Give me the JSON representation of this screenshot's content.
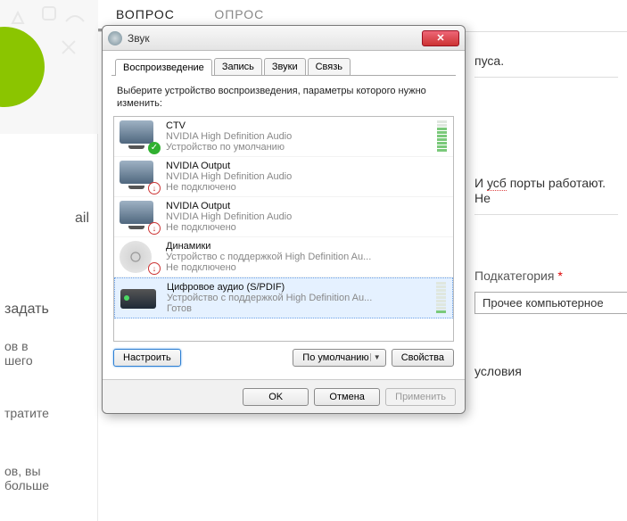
{
  "bg": {
    "tab_question": "ВОПРОС",
    "tab_poll": "ОПРОС",
    "left_ail": "ail",
    "left_zadat": "задать",
    "left_l3": "ов в",
    "left_l4": "шего",
    "left_l5": "тратите",
    "left_l6": "ов, вы",
    "left_l7": "больше",
    "right_t1": "пуса.",
    "right_t2a": "И ",
    "right_t2b": "усб",
    "right_t2c": " порты работают. Не",
    "cat_label": "Подкатегория ",
    "cat_req": "*",
    "cat_value": "Прочее компьютерное",
    "conditions": "условия"
  },
  "dialog": {
    "title": "Звук",
    "tabs": {
      "playback": "Воспроизведение",
      "record": "Запись",
      "sounds": "Звуки",
      "comm": "Связь"
    },
    "instruction": "Выберите устройство воспроизведения, параметры которого нужно изменить:",
    "devices": [
      {
        "name": "CTV",
        "driver": "NVIDIA High Definition Audio",
        "status": "Устройство по умолчанию",
        "icon": "monitor",
        "badge": "check",
        "level": 7
      },
      {
        "name": "NVIDIA Output",
        "driver": "NVIDIA High Definition Audio",
        "status": "Не подключено",
        "icon": "monitor",
        "badge": "down",
        "level": 0
      },
      {
        "name": "NVIDIA Output",
        "driver": "NVIDIA High Definition Audio",
        "status": "Не подключено",
        "icon": "monitor",
        "badge": "down",
        "level": 0
      },
      {
        "name": "Динамики",
        "driver": "Устройство с поддержкой High Definition Au...",
        "status": "Не подключено",
        "icon": "speaker",
        "badge": "down",
        "level": 0
      },
      {
        "name": "Цифровое аудио (S/PDIF)",
        "driver": "Устройство с поддержкой High Definition Au...",
        "status": "Готов",
        "icon": "amp",
        "badge": "",
        "level": 1
      }
    ],
    "btn_configure": "Настроить",
    "btn_default": "По умолчанию",
    "btn_properties": "Свойства",
    "btn_ok": "OK",
    "btn_cancel": "Отмена",
    "btn_apply": "Применить"
  }
}
